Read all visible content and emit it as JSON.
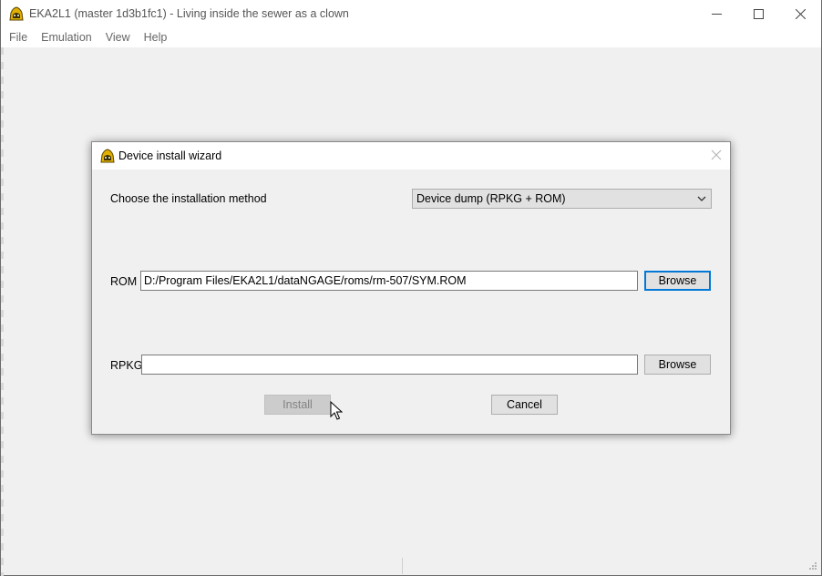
{
  "app": {
    "title": "EKA2L1 (master 1d3b1fc1) - Living inside the sewer as a clown",
    "icon": "eka2l1-logo-icon",
    "menu": [
      "File",
      "Emulation",
      "View",
      "Help"
    ]
  },
  "dialog": {
    "title": "Device install wizard",
    "method_label": "Choose the installation method",
    "method_value": "Device dump (RPKG + ROM)",
    "rom_label": "ROM",
    "rom_value": "D:/Program Files/EKA2L1/dataNGAGE/roms/rm-507/SYM.ROM",
    "rom_browse": "Browse",
    "rpkg_label": "RPKG",
    "rpkg_value": "",
    "rpkg_browse": "Browse",
    "install_label": "Install",
    "cancel_label": "Cancel"
  },
  "colors": {
    "focus_border": "#0078d7",
    "button_face": "#e1e1e1",
    "window_bg": "#f0f0f0"
  }
}
